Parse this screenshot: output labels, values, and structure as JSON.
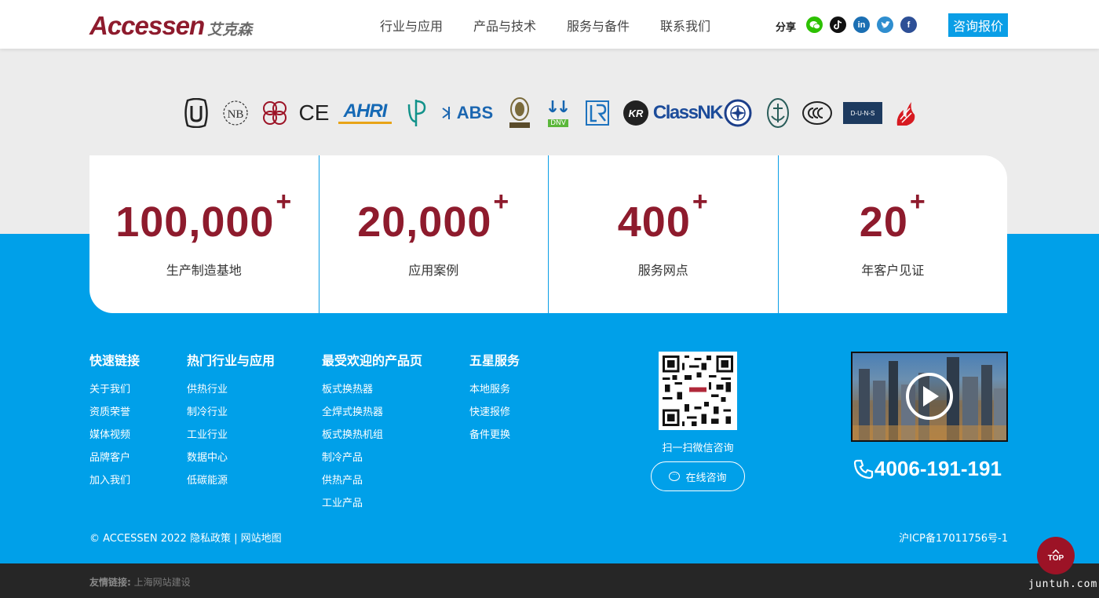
{
  "brand": {
    "name_en": "Accessen",
    "name_cn": "艾克森"
  },
  "nav": {
    "items": [
      "行业与应用",
      "产品与技术",
      "服务与备件",
      "联系我们"
    ]
  },
  "share": {
    "label": "分享",
    "icons": [
      "wechat-icon",
      "tiktok-icon",
      "linkedin-icon",
      "twitter-icon",
      "facebook-icon"
    ],
    "linkedin_text": "in",
    "facebook_text": "f"
  },
  "quote_button": "咨询报价",
  "certifications": {
    "ce": "CE",
    "ahri": "AHRI",
    "abs": "ABS",
    "classnk": "ClassNK",
    "duns": "D-U-N-S",
    "kr": "KR",
    "dnv": "DNV"
  },
  "stats": [
    {
      "value": "100,000",
      "suffix": "+",
      "label": "生产制造基地"
    },
    {
      "value": "20,000",
      "suffix": "+",
      "label": "应用案例"
    },
    {
      "value": "400",
      "suffix": "+",
      "label": "服务网点"
    },
    {
      "value": "20",
      "suffix": "+",
      "label": "年客户见证"
    }
  ],
  "footer": {
    "quick_links": {
      "title": "快速链接",
      "items": [
        "关于我们",
        "资质荣誉",
        "媒体视频",
        "品牌客户",
        "加入我们"
      ]
    },
    "industries": {
      "title": "热门行业与应用",
      "items": [
        "供热行业",
        "制冷行业",
        "工业行业",
        "数据中心",
        "低碳能源"
      ]
    },
    "products": {
      "title": "最受欢迎的产品页",
      "items": [
        "板式换热器",
        "全焊式换热器",
        "板式换热机组",
        "制冷产品",
        "供热产品",
        "工业产品"
      ]
    },
    "service": {
      "title": "五星服务",
      "items": [
        "本地服务",
        "快速报修",
        "备件更换"
      ]
    },
    "qr_caption": "扫一扫微信咨询",
    "online_consult": "在线咨询",
    "phone": "4006-191-191",
    "copyright": "© ACCESSEN 2022",
    "privacy": "隐私政策",
    "separator": "|",
    "sitemap": "网站地图",
    "icp": "沪ICP备17011756号-1",
    "friend_label": "友情链接:",
    "friend_link": "上海网站建设"
  },
  "top_button": "TOP",
  "watermark": "juntuh.com",
  "colors": {
    "brand_red": "#8e1b2d",
    "accent_blue": "#00a0e9",
    "dark_bar": "#262626"
  }
}
